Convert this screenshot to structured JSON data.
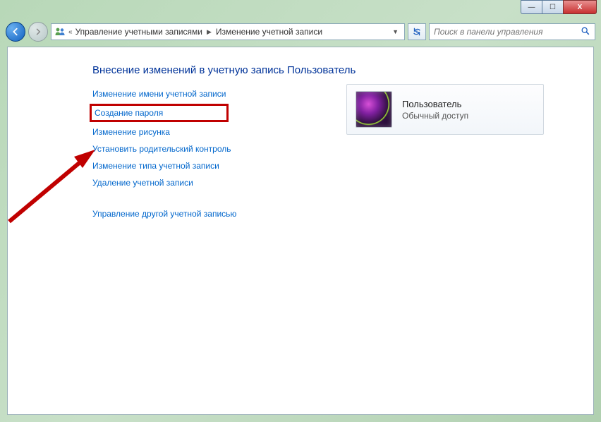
{
  "window": {
    "minimize": "—",
    "maximize": "☐",
    "close": "X"
  },
  "nav": {
    "breadcrumb": {
      "seg1": "Управление учетными записями",
      "seg2": "Изменение учетной записи"
    },
    "search_placeholder": "Поиск в панели управления"
  },
  "page": {
    "title": "Внесение изменений в учетную запись Пользователь",
    "links": [
      "Изменение имени учетной записи",
      "Создание пароля",
      "Изменение рисунка",
      "Установить родительский контроль",
      "Изменение типа учетной записи",
      "Удаление учетной записи",
      "Управление другой учетной записью"
    ]
  },
  "user": {
    "name": "Пользователь",
    "role": "Обычный доступ"
  }
}
